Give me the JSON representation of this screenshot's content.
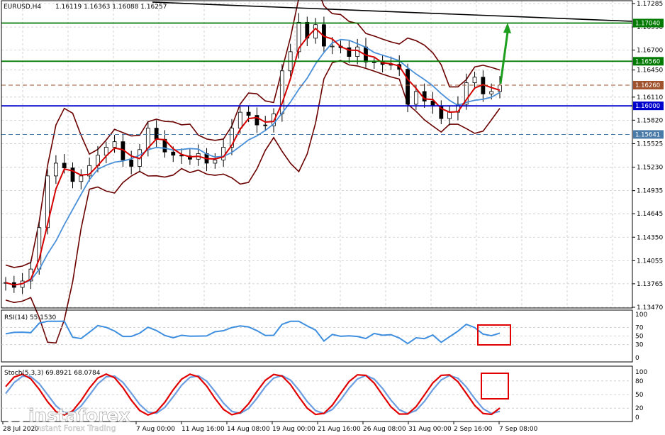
{
  "header": {
    "symbol_timeframe": "EURUSD,H4",
    "ohlc": "1.16119 1.16363 1.16088 1.16257"
  },
  "colors": {
    "frame": "#000000",
    "grid": "#c8c8c8",
    "candle": "#000000",
    "ma_fast": "#d40000",
    "ma_slow": "#4a90d9",
    "bands": "#6b0000",
    "trendline": "#000000",
    "level_green": "#007a00",
    "level_blue": "#0000cc",
    "level_brown": "#a0522d",
    "level_steel": "#4a7ba8",
    "arrow": "#1e9e1e",
    "box": "#e00000",
    "rsi_line": "#3f8fe0",
    "stoch_main": "#e00000",
    "stoch_signal": "#6b9de0"
  },
  "price_axis": {
    "ticks": [
      "1.17285",
      "1.16990",
      "1.16700",
      "1.16450",
      "1.16110",
      "1.15820",
      "1.15525",
      "1.15230",
      "1.14935",
      "1.14645",
      "1.14350",
      "1.14055",
      "1.13765",
      "1.13470"
    ]
  },
  "levels": [
    {
      "label": "1.17040",
      "value": 1.1704,
      "color": "#007a00",
      "style": "solid"
    },
    {
      "label": "1.16560",
      "value": 1.1656,
      "color": "#007a00",
      "style": "solid"
    },
    {
      "label": "1.16260",
      "value": 1.1626,
      "color": "#a0522d",
      "style": "dashed"
    },
    {
      "label": "1.16000",
      "value": 1.16,
      "color": "#0000cc",
      "style": "solid"
    },
    {
      "label": "1.15641",
      "value": 1.15641,
      "color": "#4a7ba8",
      "style": "dashed"
    }
  ],
  "time_axis": {
    "labels": [
      "28 Jul 2020",
      "7 Aug 00:00",
      "11 Aug 16:00",
      "14 Aug 08:00",
      "19 Aug 00:00",
      "21 Aug 16:00",
      "26 Aug 08:00",
      "31 Aug 00:00",
      "2 Sep 16:00",
      "7 Sep 08:00"
    ]
  },
  "rsi": {
    "label": "RSI(14) 55.1530",
    "ticks": [
      "100",
      "70",
      "50",
      "30",
      "0"
    ]
  },
  "stoch": {
    "label": "Stoch(5,3,3) 69.8921 68.0784",
    "ticks": [
      "100",
      "80",
      "50",
      "20",
      "0"
    ]
  },
  "watermark": {
    "brand": "instaforex",
    "tagline": "Instant Forex Trading"
  },
  "chart_data": {
    "type": "line",
    "title": "EURUSD,H4",
    "ylim": [
      1.1347,
      1.17285
    ],
    "series": [
      {
        "name": "price",
        "values": [
          1.1378,
          1.1372,
          1.138,
          1.1395,
          1.1447,
          1.1512,
          1.1528,
          1.1522,
          1.1505,
          1.1512,
          1.1525,
          1.1538,
          1.1548,
          1.1555,
          1.1532,
          1.1524,
          1.1545,
          1.1572,
          1.1558,
          1.1542,
          1.1538,
          1.1537,
          1.1533,
          1.154,
          1.1528,
          1.1532,
          1.1548,
          1.1572,
          1.1592,
          1.1588,
          1.1576,
          1.1575,
          1.159,
          1.1644,
          1.1668,
          1.1705,
          1.1685,
          1.1702,
          1.1675,
          1.1675,
          1.1673,
          1.1662,
          1.1674,
          1.1655,
          1.1655,
          1.1652,
          1.1652,
          1.1646,
          1.1602,
          1.1618,
          1.1606,
          1.16,
          1.1584,
          1.1592,
          1.1602,
          1.1629,
          1.1636,
          1.1615,
          1.1618,
          1.1626
        ]
      }
    ],
    "indicators": {
      "rsi_value": 55.153,
      "stoch_main": 69.8921,
      "stoch_signal": 68.0784
    }
  }
}
